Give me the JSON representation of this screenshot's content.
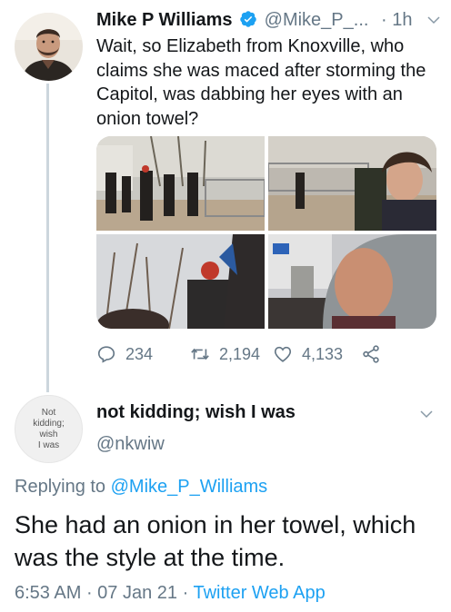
{
  "tweet": {
    "author_name": "Mike P Williams",
    "handle": "@Mike_P_...",
    "dot": "·",
    "time": "1h",
    "text": "Wait, so Elizabeth from Knoxville, who claims she was maced after storming the Capitol, was dabbing her eyes with an onion towel?",
    "counts": {
      "replies": "234",
      "retweets": "2,194",
      "likes": "4,133"
    },
    "icons": [
      "verified-badge-icon",
      "chevron-down-icon",
      "reply-icon",
      "retweet-icon",
      "like-icon",
      "share-icon"
    ]
  },
  "reply": {
    "avatar_text": [
      "Not",
      "kidding;",
      "wish",
      "I was"
    ],
    "author_name": "not kidding; wish I was",
    "handle": "@nkwiw",
    "replying_prefix": "Replying to ",
    "replying_to": "@Mike_P_Williams",
    "text": "She had an onion in her towel, which was the style at the time.",
    "time": "6:53 AM",
    "sep1": " · ",
    "date": "07 Jan 21",
    "sep2": " · ",
    "app": "Twitter Web App"
  },
  "colors": {
    "link_blue": "#1da1f2",
    "secondary_text": "#657786",
    "primary_text": "#14171a",
    "thread_line": "#ccd6dd"
  }
}
